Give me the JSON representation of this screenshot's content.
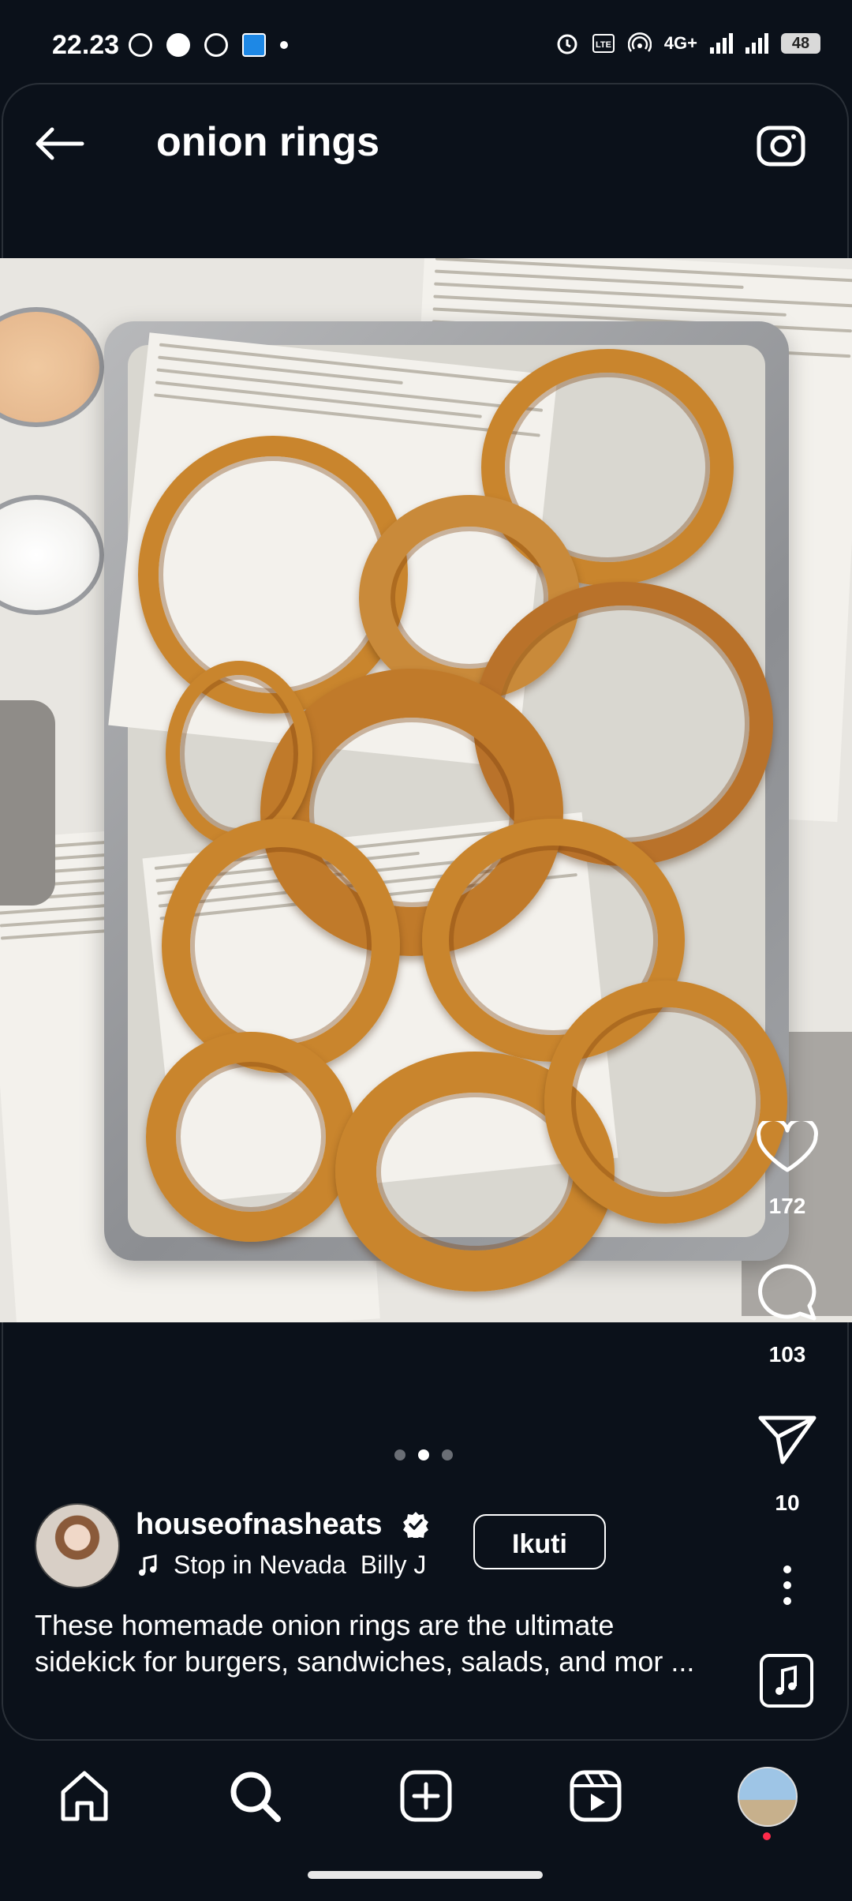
{
  "status_bar": {
    "time": "22.23",
    "signal_label": "4G+",
    "battery": "48"
  },
  "header": {
    "title": "onion rings"
  },
  "post": {
    "image_alt": "Crispy onion rings on a metal tray lined with newspaper print paper, with two dipping sauces",
    "likes": "172",
    "comments": "103",
    "shares": "10",
    "carousel": {
      "count": 3,
      "active_index": 1
    },
    "username": "houseofnasheats",
    "verified": true,
    "music_title": "Stop in Nevada",
    "music_artist": "Billy J",
    "follow_label": "Ikuti",
    "caption": "These homemade onion rings are the ultimate sidekick for burgers, sandwiches, salads, and mor ..."
  },
  "icons": {
    "back": "arrow-left-icon",
    "camera": "camera-icon",
    "like": "heart-icon",
    "comment": "comment-bubble-icon",
    "share": "paper-plane-icon",
    "more": "more-vertical-icon",
    "audio": "music-note-icon"
  },
  "nav": {
    "items": [
      "home",
      "search",
      "create",
      "reels",
      "profile"
    ],
    "active": "search"
  },
  "colors": {
    "background": "#0b111a",
    "accent_red": "#ff2a4a",
    "verified": "#ffffff"
  }
}
